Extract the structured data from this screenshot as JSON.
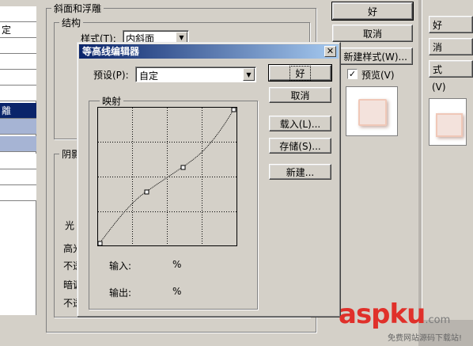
{
  "left_list": {
    "items": [
      "",
      "定",
      "",
      "",
      "",
      "",
      "離",
      "",
      "",
      "",
      "",
      ""
    ]
  },
  "bg_dialog": {
    "group_bevel_title": "斜面和浮雕",
    "group_structure_title": "结构",
    "style_label": "样式(T):",
    "style_value": "内斜面",
    "group_shadow_title": "阴影",
    "light_label": "光",
    "highlight_label": "高光",
    "opacity_label_1": "不透",
    "shadow_mode_label": "暗调",
    "opacity_label_2": "不透",
    "ok_label": "好",
    "cancel_label": "取消",
    "new_style_label": "新建样式(W)...",
    "preview_label": "预览(V)"
  },
  "right_panel": {
    "item1": "好",
    "item2": "消",
    "item3": "式",
    "item4": "(V)"
  },
  "contour_dialog": {
    "title": "等高线编辑器",
    "close_glyph": "✕",
    "preset_label": "预设(P):",
    "preset_value": "自定",
    "mapping_title": "映射",
    "input_label": "输入:",
    "input_unit": "%",
    "output_label": "输出:",
    "output_unit": "%",
    "ok_label": "好",
    "cancel_label": "取消",
    "load_label": "载入(L)...",
    "save_label": "存储(S)...",
    "new_label": "新建..."
  },
  "watermark": {
    "brand_main": "aspku",
    "brand_tld": ".com",
    "tagline": "免费网站源码下载站!"
  },
  "colors": {
    "titlebar_start": "#0a246a",
    "titlebar_end": "#a6caf0",
    "selection": "#0a246a",
    "watermark_red": "#e0302a"
  }
}
